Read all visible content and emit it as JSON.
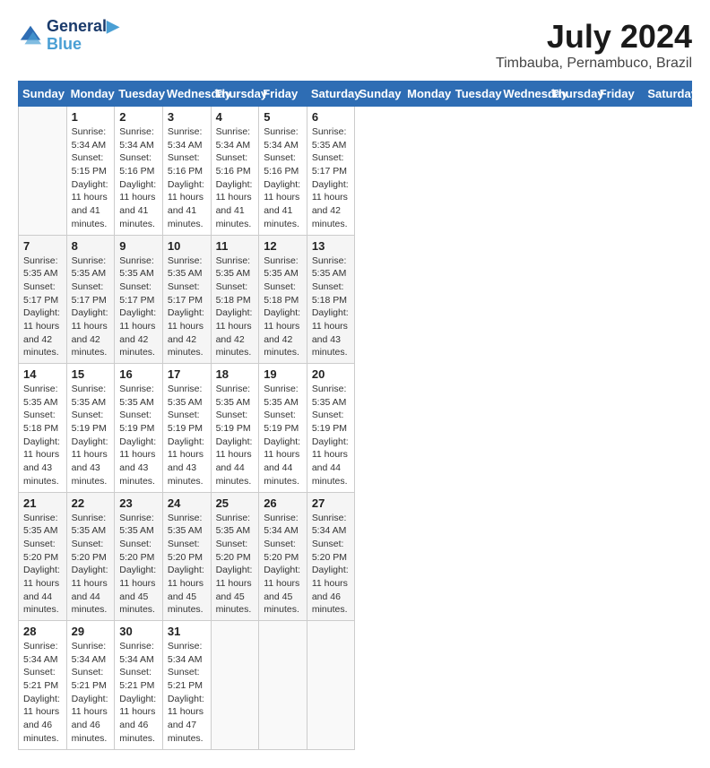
{
  "header": {
    "logo_line1": "General",
    "logo_line2": "Blue",
    "month_title": "July 2024",
    "location": "Timbauba, Pernambuco, Brazil"
  },
  "days_of_week": [
    "Sunday",
    "Monday",
    "Tuesday",
    "Wednesday",
    "Thursday",
    "Friday",
    "Saturday"
  ],
  "weeks": [
    [
      {
        "day": "",
        "info": ""
      },
      {
        "day": "1",
        "info": "Sunrise: 5:34 AM\nSunset: 5:15 PM\nDaylight: 11 hours\nand 41 minutes."
      },
      {
        "day": "2",
        "info": "Sunrise: 5:34 AM\nSunset: 5:16 PM\nDaylight: 11 hours\nand 41 minutes."
      },
      {
        "day": "3",
        "info": "Sunrise: 5:34 AM\nSunset: 5:16 PM\nDaylight: 11 hours\nand 41 minutes."
      },
      {
        "day": "4",
        "info": "Sunrise: 5:34 AM\nSunset: 5:16 PM\nDaylight: 11 hours\nand 41 minutes."
      },
      {
        "day": "5",
        "info": "Sunrise: 5:34 AM\nSunset: 5:16 PM\nDaylight: 11 hours\nand 41 minutes."
      },
      {
        "day": "6",
        "info": "Sunrise: 5:35 AM\nSunset: 5:17 PM\nDaylight: 11 hours\nand 42 minutes."
      }
    ],
    [
      {
        "day": "7",
        "info": "Sunrise: 5:35 AM\nSunset: 5:17 PM\nDaylight: 11 hours\nand 42 minutes."
      },
      {
        "day": "8",
        "info": "Sunrise: 5:35 AM\nSunset: 5:17 PM\nDaylight: 11 hours\nand 42 minutes."
      },
      {
        "day": "9",
        "info": "Sunrise: 5:35 AM\nSunset: 5:17 PM\nDaylight: 11 hours\nand 42 minutes."
      },
      {
        "day": "10",
        "info": "Sunrise: 5:35 AM\nSunset: 5:17 PM\nDaylight: 11 hours\nand 42 minutes."
      },
      {
        "day": "11",
        "info": "Sunrise: 5:35 AM\nSunset: 5:18 PM\nDaylight: 11 hours\nand 42 minutes."
      },
      {
        "day": "12",
        "info": "Sunrise: 5:35 AM\nSunset: 5:18 PM\nDaylight: 11 hours\nand 42 minutes."
      },
      {
        "day": "13",
        "info": "Sunrise: 5:35 AM\nSunset: 5:18 PM\nDaylight: 11 hours\nand 43 minutes."
      }
    ],
    [
      {
        "day": "14",
        "info": "Sunrise: 5:35 AM\nSunset: 5:18 PM\nDaylight: 11 hours\nand 43 minutes."
      },
      {
        "day": "15",
        "info": "Sunrise: 5:35 AM\nSunset: 5:19 PM\nDaylight: 11 hours\nand 43 minutes."
      },
      {
        "day": "16",
        "info": "Sunrise: 5:35 AM\nSunset: 5:19 PM\nDaylight: 11 hours\nand 43 minutes."
      },
      {
        "day": "17",
        "info": "Sunrise: 5:35 AM\nSunset: 5:19 PM\nDaylight: 11 hours\nand 43 minutes."
      },
      {
        "day": "18",
        "info": "Sunrise: 5:35 AM\nSunset: 5:19 PM\nDaylight: 11 hours\nand 44 minutes."
      },
      {
        "day": "19",
        "info": "Sunrise: 5:35 AM\nSunset: 5:19 PM\nDaylight: 11 hours\nand 44 minutes."
      },
      {
        "day": "20",
        "info": "Sunrise: 5:35 AM\nSunset: 5:19 PM\nDaylight: 11 hours\nand 44 minutes."
      }
    ],
    [
      {
        "day": "21",
        "info": "Sunrise: 5:35 AM\nSunset: 5:20 PM\nDaylight: 11 hours\nand 44 minutes."
      },
      {
        "day": "22",
        "info": "Sunrise: 5:35 AM\nSunset: 5:20 PM\nDaylight: 11 hours\nand 44 minutes."
      },
      {
        "day": "23",
        "info": "Sunrise: 5:35 AM\nSunset: 5:20 PM\nDaylight: 11 hours\nand 45 minutes."
      },
      {
        "day": "24",
        "info": "Sunrise: 5:35 AM\nSunset: 5:20 PM\nDaylight: 11 hours\nand 45 minutes."
      },
      {
        "day": "25",
        "info": "Sunrise: 5:35 AM\nSunset: 5:20 PM\nDaylight: 11 hours\nand 45 minutes."
      },
      {
        "day": "26",
        "info": "Sunrise: 5:34 AM\nSunset: 5:20 PM\nDaylight: 11 hours\nand 45 minutes."
      },
      {
        "day": "27",
        "info": "Sunrise: 5:34 AM\nSunset: 5:20 PM\nDaylight: 11 hours\nand 46 minutes."
      }
    ],
    [
      {
        "day": "28",
        "info": "Sunrise: 5:34 AM\nSunset: 5:21 PM\nDaylight: 11 hours\nand 46 minutes."
      },
      {
        "day": "29",
        "info": "Sunrise: 5:34 AM\nSunset: 5:21 PM\nDaylight: 11 hours\nand 46 minutes."
      },
      {
        "day": "30",
        "info": "Sunrise: 5:34 AM\nSunset: 5:21 PM\nDaylight: 11 hours\nand 46 minutes."
      },
      {
        "day": "31",
        "info": "Sunrise: 5:34 AM\nSunset: 5:21 PM\nDaylight: 11 hours\nand 47 minutes."
      },
      {
        "day": "",
        "info": ""
      },
      {
        "day": "",
        "info": ""
      },
      {
        "day": "",
        "info": ""
      }
    ]
  ]
}
